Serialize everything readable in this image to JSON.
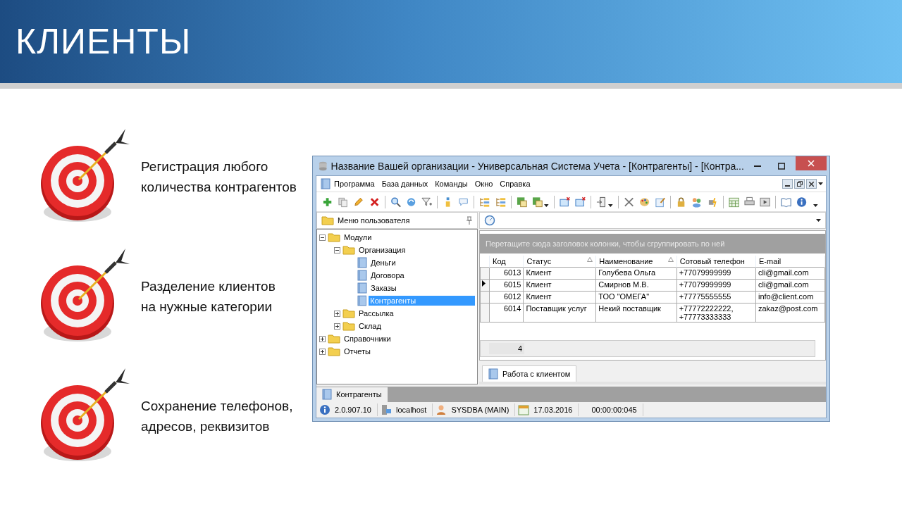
{
  "slide": {
    "title": "КЛИЕНТЫ",
    "points": [
      {
        "text": "Регистрация любого\nколичества контрагентов"
      },
      {
        "text": "Разделение клиентов\nна нужные категории"
      },
      {
        "text": "Сохранение телефонов,\nадресов, реквизитов"
      }
    ]
  },
  "window": {
    "title": "Название Вашей организации - Универсальная Система Учета - [Контрагенты] - [Контра...",
    "menu": [
      "Программа",
      "База данных",
      "Команды",
      "Окно",
      "Справка"
    ],
    "left_panel": {
      "title": "Меню пользователя",
      "tree": [
        {
          "label": "Модули",
          "kind": "folder",
          "expanded": true,
          "selected": false,
          "children": [
            {
              "label": "Организация",
              "kind": "folder",
              "expanded": true,
              "selected": false,
              "children": [
                {
                  "label": "Деньги",
                  "kind": "document",
                  "selected": false
                },
                {
                  "label": "Договора",
                  "kind": "document",
                  "selected": false
                },
                {
                  "label": "Заказы",
                  "kind": "document",
                  "selected": false
                },
                {
                  "label": "Контрагенты",
                  "kind": "document",
                  "selected": true
                }
              ]
            },
            {
              "label": "Рассылка",
              "kind": "folder",
              "expanded": false,
              "selected": false
            },
            {
              "label": "Склад",
              "kind": "folder",
              "expanded": false,
              "selected": false
            }
          ]
        },
        {
          "label": "Справочники",
          "kind": "folder",
          "expanded": false,
          "selected": false
        },
        {
          "label": "Отчеты",
          "kind": "folder",
          "expanded": false,
          "selected": false
        }
      ]
    },
    "grid": {
      "group_hint": "Перетащите сюда заголовок колонки, чтобы сгруппировать по ней",
      "columns": [
        {
          "label": "Код",
          "sort_mark": false
        },
        {
          "label": "Статус",
          "sort_mark": true
        },
        {
          "label": "Наименование",
          "sort_mark": true
        },
        {
          "label": "Сотовый телефон",
          "sort_mark": false
        },
        {
          "label": "E-mail",
          "sort_mark": false
        }
      ],
      "rows": [
        {
          "selected": false,
          "cells": [
            "6013",
            "Клиент",
            "Голубева Ольга",
            "+77079999999",
            "cli@gmail.com"
          ]
        },
        {
          "selected": true,
          "cells": [
            "6015",
            "Клиент",
            "Смирнов М.В.",
            "+77079999999",
            "cli@gmail.com"
          ]
        },
        {
          "selected": false,
          "cells": [
            "6012",
            "Клиент",
            "ТОО \"ОМЕГА\"",
            "+77775555555",
            "info@client.com"
          ]
        },
        {
          "selected": false,
          "cells": [
            "6014",
            "Поставщик услуг",
            "Некий поставщик",
            "+77772222222,\n+77773333333",
            "zakaz@post.com"
          ]
        }
      ],
      "footer_count": "4"
    },
    "inner_tabs": [
      {
        "label": "Работа с клиентом",
        "selected": true
      }
    ],
    "document_tabs": [
      {
        "label": "Контрагенты",
        "selected": true
      }
    ],
    "status_bar": [
      {
        "kind": "version",
        "text": "2.0.907.10"
      },
      {
        "kind": "server",
        "text": "localhost"
      },
      {
        "kind": "user",
        "text": "SYSDBA (MAIN)"
      },
      {
        "kind": "date",
        "text": "17.03.2016"
      },
      {
        "kind": "timer",
        "text": "00:00:00:045"
      }
    ]
  }
}
